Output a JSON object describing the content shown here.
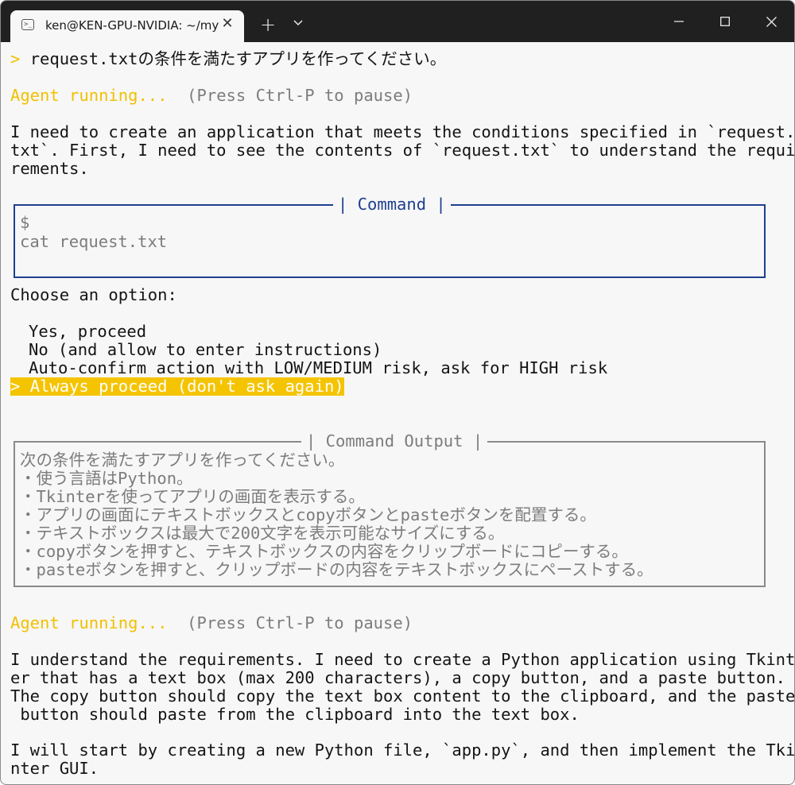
{
  "window": {
    "tab_title": "ken@KEN-GPU-NVIDIA: ~/my",
    "tab_icon_glyph": ">_",
    "new_tab_label": "+",
    "close_tab_label": "✕"
  },
  "terminal": {
    "prompt_arrow": ">",
    "user_request": "request.txtの条件を満たすアプリを作ってください。",
    "agent_running_1": "Agent running...",
    "pause_hint_1": "(Press Ctrl-P to pause)",
    "agent_msg_1": [
      "I need to create an application that meets the conditions specified in `request.",
      "txt`. First, I need to see the contents of `request.txt` to understand the requi",
      "rements."
    ],
    "command_box": {
      "label": "| Command |",
      "dollar": "$",
      "command": "cat request.txt"
    },
    "choose_option": "Choose an option:",
    "options": [
      "Yes, proceed",
      "No (and allow to enter instructions)",
      "Auto-confirm action with LOW/MEDIUM risk, ask for HIGH risk",
      "Always proceed (don't ask again)"
    ],
    "selected_marker": ">",
    "output_box": {
      "label": "| Command Output |",
      "lines": [
        "次の条件を満たすアプリを作ってください。",
        "・使う言語はPython。",
        "・Tkinterを使ってアプリの画面を表示する。",
        "・アプリの画面にテキストボックスとcopyボタンとpasteボタンを配置する。",
        "・テキストボックスは最大で200文字を表示可能なサイズにする。",
        "・copyボタンを押すと、テキストボックスの内容をクリップボードにコピーする。",
        "・pasteボタンを押すと、クリップボードの内容をテキストボックスにペーストする。"
      ]
    },
    "agent_running_2": "Agent running...",
    "pause_hint_2": "(Press Ctrl-P to pause)",
    "agent_msg_2": [
      "I understand the requirements. I need to create a Python application using Tkint",
      "er that has a text box (max 200 characters), a copy button, and a paste button.",
      "The copy button should copy the text box content to the clipboard, and the paste",
      " button should paste from the clipboard into the text box."
    ],
    "agent_msg_3": [
      "I will start by creating a new Python file, `app.py`, and then implement the Tki",
      "nter GUI."
    ]
  },
  "colors": {
    "accent_yellow": "#f2c000",
    "command_blue": "#1f3f8f",
    "muted_gray": "#7c7c7c",
    "titlebar": "#202020"
  }
}
